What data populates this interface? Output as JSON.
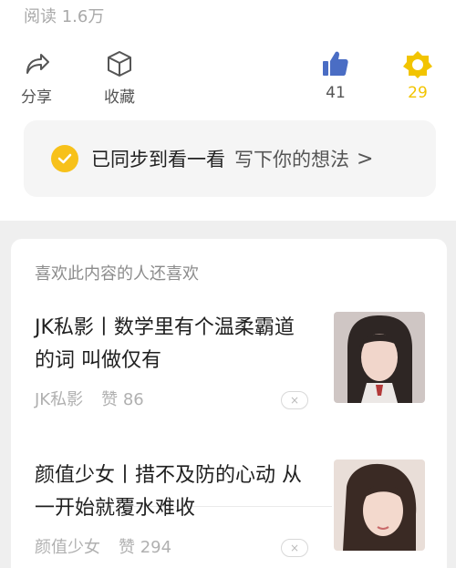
{
  "article": {
    "read_count": "阅读 1.6万"
  },
  "actions": {
    "share": {
      "label": "分享",
      "icon": "share-arrow-icon"
    },
    "favorite": {
      "label": "收藏",
      "icon": "cube-icon"
    },
    "like": {
      "count": "41",
      "icon": "thumbs-up-icon"
    },
    "wow": {
      "count": "29",
      "icon": "flower-icon",
      "color": "#f2c400"
    }
  },
  "sync": {
    "status": "已同步到看一看",
    "link": "写下你的想法",
    "chevron": ">"
  },
  "recommend": {
    "heading": "喜欢此内容的人还喜欢",
    "items": [
      {
        "title": "JK私影丨数学里有个温柔霸道的词 叫做仅有",
        "source": "JK私影",
        "likes": "赞 86",
        "dismiss": "×"
      },
      {
        "title": "颜值少女丨措不及防的心动 从一开始就覆水难收",
        "source": "颜值少女",
        "likes": "赞 294",
        "dismiss": "×"
      }
    ]
  }
}
